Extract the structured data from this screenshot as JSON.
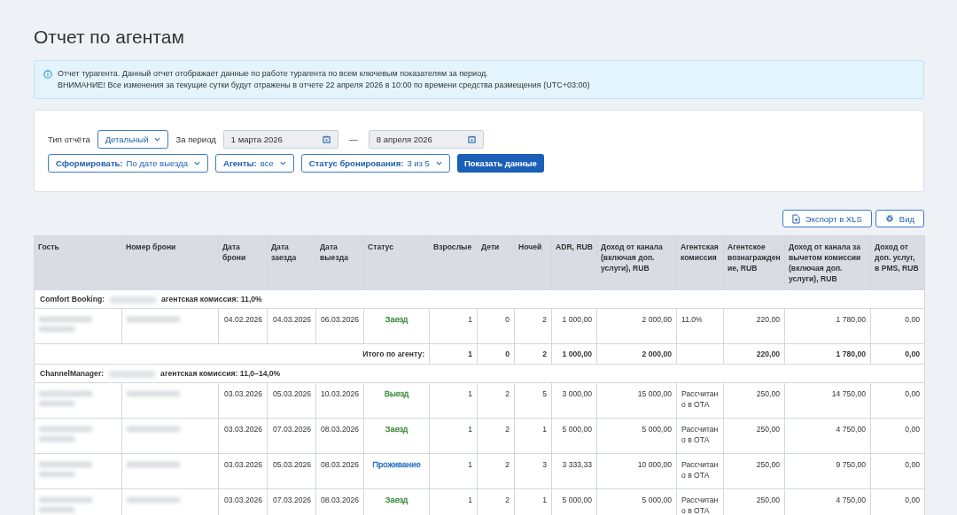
{
  "title": "Отчет по агентам",
  "info": {
    "lines": [
      "Отчет турагента. Данный отчет отображает данные по работе турагента по всем ключевым показателям за период.",
      "ВНИМАНИЕ! Все изменения за текущие сутки будут отражены в отчете 22 апреля 2026 в 10:00 по времени средства размещения (UTC+03:00)"
    ]
  },
  "filters": {
    "report_type": {
      "label": "Тип отчёта",
      "value": "Детальный"
    },
    "period": {
      "label": "За период",
      "from": "1 марта 2026",
      "separator": "—",
      "to": "8 апреля 2026"
    },
    "dropdowns": [
      {
        "label": "Сформировать:",
        "value": "По дате выезда"
      },
      {
        "label": "Агенты:",
        "value": "все"
      },
      {
        "label": "Статус бронирования:",
        "value": "3 из 5"
      }
    ],
    "submit": "Показать данные"
  },
  "actions": [
    {
      "kind": "export",
      "label": "Экспорт в XLS"
    },
    {
      "kind": "view",
      "label": "Вид"
    }
  ],
  "table": {
    "columns": [
      "Гость",
      "Номер брони",
      "Дата брони",
      "Дата заезда",
      "Дата выезда",
      "Статус",
      "Взрослые",
      "Дети",
      "Ночей",
      "ADR, RUB",
      "Доход от канала (включая доп. услуги), RUB",
      "Агентская комиссия",
      "Агентское вознаграждение, RUB",
      "Доход от канала за вычетом комиссии (включая доп. услуги), RUB",
      "Доход от доп. услуг, в PMS, RUB"
    ],
    "groups": [
      {
        "agent": "Comfort Booking:",
        "commission": "агентская комиссия: 11,0%",
        "rows": [
          {
            "booked": "04.02.2026",
            "arrival": "04.03.2026",
            "departure": "06.03.2026",
            "status": {
              "text": "Заезд",
              "color": "#3a8a3a"
            },
            "adults": "1",
            "children": "0",
            "nights": "2",
            "adr": "1 000,00",
            "revenue": "2 000,00",
            "commission": "11.0%",
            "reward": "220,00",
            "net": "1 780,00",
            "services": "0,00"
          }
        ],
        "total": {
          "label": "Итого по агенту:",
          "adults": "1",
          "children": "0",
          "nights": "2",
          "adr": "1 000,00",
          "revenue": "2 000,00",
          "reward": "220,00",
          "net": "1 780,00",
          "services": "0,00"
        }
      },
      {
        "agent": "ChannelManager:",
        "commission": "агентская комиссия: 11,0–14,0%",
        "rows": [
          {
            "booked": "03.03.2026",
            "arrival": "05.03.2026",
            "departure": "10.03.2026",
            "status": {
              "text": "Выезд",
              "color": "#3a8a3a"
            },
            "adults": "1",
            "children": "2",
            "nights": "5",
            "adr": "3 000,00",
            "revenue": "15 000,00",
            "commission": "Рассчитано в ОТА",
            "reward": "250,00",
            "net": "14 750,00",
            "services": "0,00"
          },
          {
            "booked": "03.03.2026",
            "arrival": "07.03.2026",
            "departure": "08.03.2026",
            "status": {
              "text": "Заезд",
              "color": "#3a8a3a"
            },
            "adults": "1",
            "children": "2",
            "nights": "1",
            "adr": "5 000,00",
            "revenue": "5 000,00",
            "commission": "Рассчитано в ОТА",
            "reward": "250,00",
            "net": "4 750,00",
            "services": "0,00"
          },
          {
            "booked": "03.03.2026",
            "arrival": "05.03.2026",
            "departure": "08.03.2026",
            "status": {
              "text": "Проживание",
              "color": "#1f6fc0"
            },
            "adults": "1",
            "children": "2",
            "nights": "3",
            "adr": "3 333,33",
            "revenue": "10 000,00",
            "commission": "Рассчитано в ОТА",
            "reward": "250,00",
            "net": "9 750,00",
            "services": "0,00"
          },
          {
            "booked": "03.03.2026",
            "arrival": "07.03.2026",
            "departure": "08.03.2026",
            "status": {
              "text": "Заезд",
              "color": "#3a8a3a"
            },
            "adults": "1",
            "children": "2",
            "nights": "1",
            "adr": "5 000,00",
            "revenue": "5 000,00",
            "commission": "Рассчитано в ОТА",
            "reward": "250,00",
            "net": "4 750,00",
            "services": "0,00"
          }
        ]
      }
    ]
  }
}
